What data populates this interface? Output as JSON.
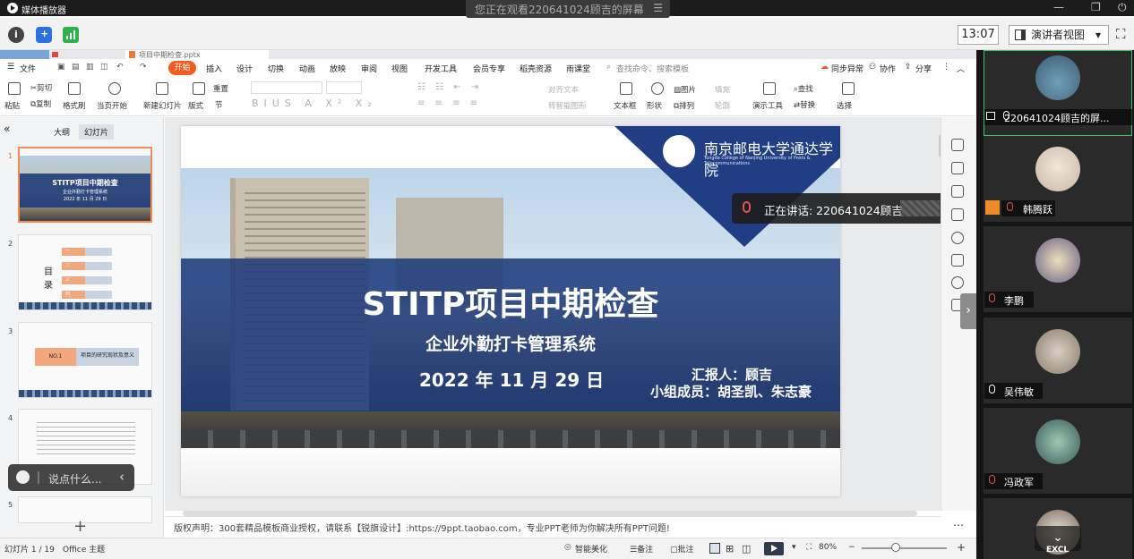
{
  "player": {
    "title": "媒体播放器",
    "viewing": "您正在观看220641024顾吉的屏幕",
    "menu_glyph": "☰",
    "min": "—",
    "max": "❐",
    "close": "⏻"
  },
  "topbar": {
    "time": "13:07",
    "presenter_view": "演讲者视图",
    "presenter_caret": "▾",
    "expand": "⛶"
  },
  "tabs": {
    "t1": "",
    "t2": "项目中期检查.pptx"
  },
  "menu": {
    "file": "文件",
    "start": "开始",
    "insert": "插入",
    "design": "设计",
    "transition": "切换",
    "animation": "动画",
    "slideshow": "放映",
    "review": "审阅",
    "view": "视图",
    "dev": "开发工具",
    "member": "会员专享",
    "daoke": "稻壳资源",
    "yuketang": "雨课堂",
    "search": "查找命令、搜索模板",
    "sync": "同步异常",
    "collab": "协作",
    "share": "分享"
  },
  "ribbon": {
    "paste": "粘贴",
    "cut": "剪切",
    "copy": "复制",
    "painter": "格式刷",
    "from_current": "当页开始",
    "new_slide": "新建幻灯片",
    "layout": "版式",
    "section": "节",
    "reset": "重置",
    "textbox": "文本框",
    "shape": "形状",
    "picture": "图片",
    "fill": "填充",
    "arrange": "排列",
    "outline": "轮廓",
    "present_tools": "演示工具",
    "find": "查找",
    "replace": "替换",
    "select": "选择",
    "align_text": "对齐文本",
    "smartart": "转智能图形"
  },
  "panel": {
    "outline_tab": "大纲",
    "slides_tab": "幻灯片",
    "collapse": "«",
    "add": "+",
    "nums": [
      "1",
      "2",
      "3",
      "4",
      "5"
    ],
    "thumb1_title": "STITP项目中期检查",
    "thumb1_sub": "企业外勤打卡管理系统",
    "thumb1_date": "2022 年 11 月 29 日",
    "thumb2_heading": "目录",
    "thumb2_items": [
      "一",
      "二",
      "三",
      "四"
    ],
    "thumb3_no": "NO.1",
    "thumb3_text": "项目的研究现状及意义"
  },
  "chat": {
    "placeholder": "说点什么...",
    "arrow": "‹"
  },
  "slide": {
    "logo_text": "南京邮电大学通达学院",
    "logo_sub": "Tongda College of Nanjing University of Posts & Telecommunications",
    "title": "STITP项目中期检查",
    "subtitle": "企业外勤打卡管理系统",
    "date": "2022 年 11 月 29 日",
    "reporter": "汇报人：顾吉",
    "members": "小组成员：胡圣凯、朱志豪"
  },
  "speaking": {
    "label": "正在讲话: 220641024顾吉"
  },
  "notes": {
    "text": "版权声明：300套精品模板商业授权，请联系【锐旗设计】:https://9ppt.taobao.com，专业PPT老师为你解决所有PPT问题!"
  },
  "status": {
    "slide_count": "幻灯片 1 / 19",
    "theme": "Office 主题",
    "beautify": "智能美化",
    "notes": "备注",
    "comments": "批注",
    "zoom": "80%",
    "minus": "−",
    "plus": "+"
  },
  "participants": [
    {
      "name": "220641024顾吉的屏..."
    },
    {
      "name": "韩腾跃"
    },
    {
      "name": "李鹏"
    },
    {
      "name": "吴伟敏"
    },
    {
      "name": "冯政军"
    },
    {
      "name": "EXCL"
    }
  ],
  "colors": {
    "accent_orange": "#f55a1e",
    "slide_blue": "#1a3879",
    "active_green": "#39c36b"
  }
}
